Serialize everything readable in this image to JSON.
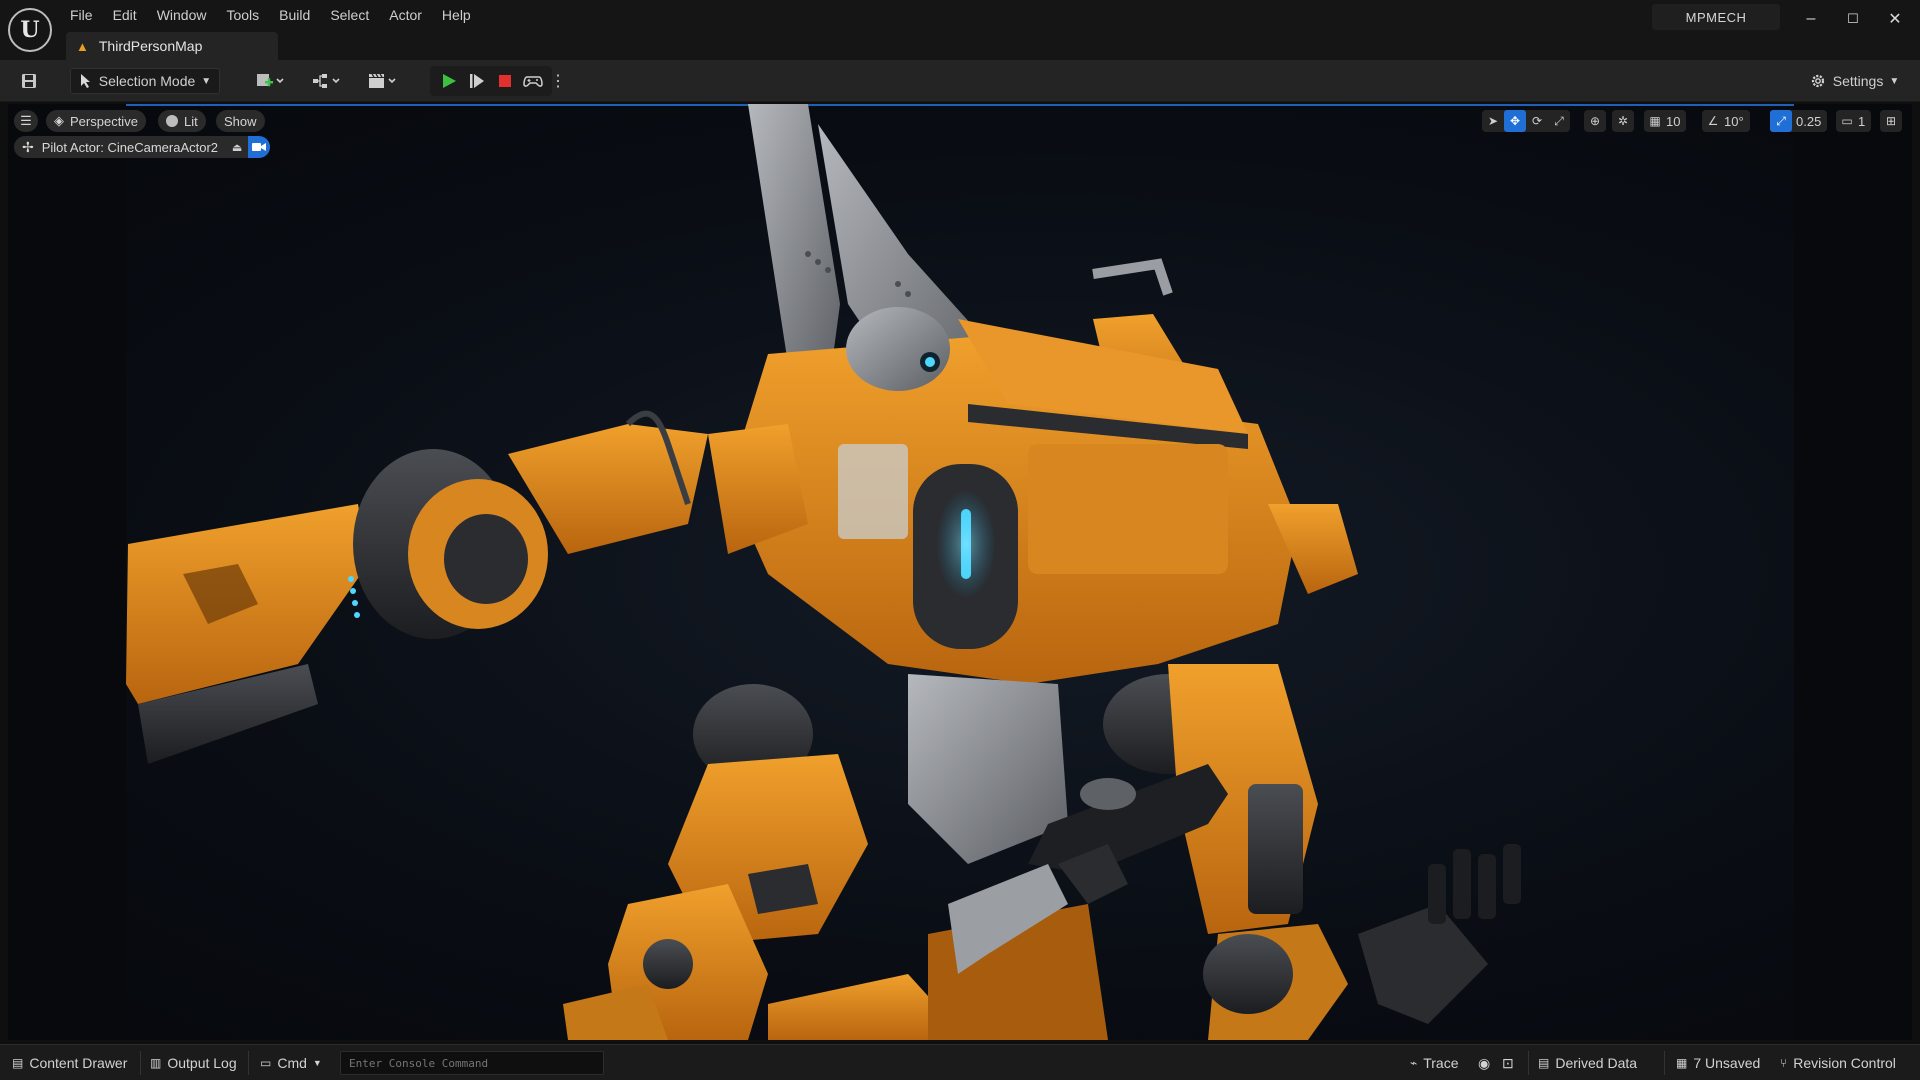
{
  "app": {
    "logo_text": "U",
    "project_name": "MPMECH",
    "map_tab": "ThirdPersonMap"
  },
  "menu": [
    "File",
    "Edit",
    "Window",
    "Tools",
    "Build",
    "Select",
    "Actor",
    "Help"
  ],
  "window_controls": {
    "minimize": "–",
    "maximize": "☐",
    "close": "✕"
  },
  "toolbar": {
    "save_icon": "save-icon",
    "selection_mode": "Selection Mode",
    "settings": "Settings",
    "more": "⋮"
  },
  "viewport": {
    "perspective": "Perspective",
    "lit": "Lit",
    "show": "Show",
    "pilot_actor": "Pilot Actor: CineCameraActor2",
    "grid_snap": "10",
    "rotation_snap": "10°",
    "scale_snap": "0.25",
    "camera_speed": "1",
    "accent_color": "#1f6fd6"
  },
  "statusbar": {
    "content_drawer": "Content Drawer",
    "output_log": "Output Log",
    "cmd": "Cmd",
    "console_placeholder": "Enter Console Command",
    "trace": "Trace",
    "derived_data": "Derived Data",
    "unsaved": "7 Unsaved",
    "revision_control": "Revision Control"
  },
  "colors": {
    "mech_orange": "#e08a1e",
    "mech_dark": "#2a2c30",
    "mech_steel": "#8a8d92",
    "glow": "#38c8ff"
  }
}
